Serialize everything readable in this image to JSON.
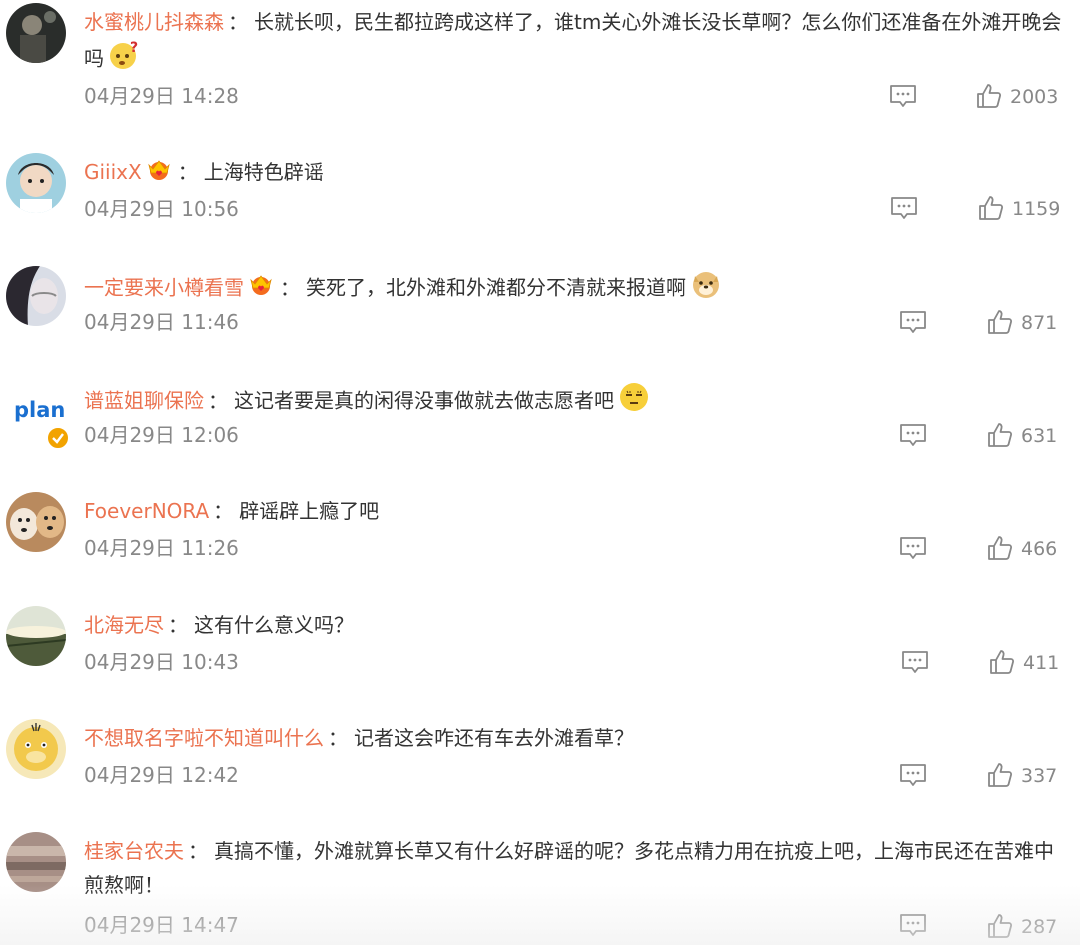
{
  "comments": [
    {
      "user": "水蜜桃儿抖森森",
      "colon": "：",
      "text": "长就长呗，民生都拉跨成这样了，谁tm关心外滩长没长草啊？怎么你们还准备在外滩开晚会吗",
      "emoji": "question-face-emoji",
      "time": "04月29日 14:28",
      "likes": "2003",
      "vip": false
    },
    {
      "user": "GiiixX",
      "colon": "：",
      "text": "上海特色辟谣",
      "emoji": "",
      "time": "04月29日 10:56",
      "likes": "1159",
      "vip": true
    },
    {
      "user": "一定要来小樽看雪",
      "colon": "：",
      "text": "笑死了，北外滩和外滩都分不清就来报道啊",
      "emoji": "doge-emoji",
      "time": "04月29日 11:46",
      "likes": "871",
      "vip": true
    },
    {
      "user": "谱蓝姐聊保险",
      "colon": "：",
      "text": "这记者要是真的闲得没事做就去做志愿者吧",
      "emoji": "sleepy-face-emoji",
      "time": "04月29日 12:06",
      "likes": "631",
      "vip": false,
      "avatar_text": "plan"
    },
    {
      "user": "FoeverNORA",
      "colon": "：",
      "text": "辟谣辟上瘾了吧",
      "emoji": "",
      "time": "04月29日 11:26",
      "likes": "466",
      "vip": false
    },
    {
      "user": "北海无尽",
      "colon": "：",
      "text": "这有什么意义吗？",
      "emoji": "",
      "time": "04月29日 10:43",
      "likes": "411",
      "vip": false
    },
    {
      "user": "不想取名字啦不知道叫什么",
      "colon": "：",
      "text": "记者这会咋还有车去外滩看草？",
      "emoji": "",
      "time": "04月29日 12:42",
      "likes": "337",
      "vip": false
    },
    {
      "user": "桂家台农夫",
      "colon": "：",
      "text": "真搞不懂，外滩就算长草又有什么好辟谣的呢？多花点精力用在抗疫上吧，上海市民还在苦难中煎熬啊！",
      "emoji": "",
      "time": "04月29日 14:47",
      "likes": "287",
      "vip": false
    }
  ],
  "colors": {
    "username": "#eb7350",
    "meta": "#888888",
    "text": "#333333"
  }
}
